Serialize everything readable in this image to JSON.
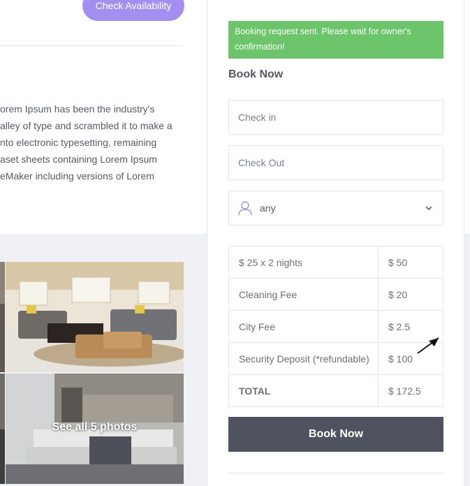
{
  "header": {
    "check_availability_label": "Check Availability"
  },
  "description": {
    "lines": [
      "orem Ipsum has been the industry's",
      "alley of type and scrambled it to make a",
      "nto electronic typesetting, remaining",
      "aset sheets containing Lorem Ipsum",
      "eMaker including versions of Lorem"
    ]
  },
  "gallery": {
    "see_all_label": "See all 5 photos"
  },
  "sidebar": {
    "alert_text": "Booking request sent. Please wait for owner's confirmation!",
    "title": "Book Now",
    "check_in_placeholder": "Check in",
    "check_out_placeholder": "Check Out",
    "guests_value": "any",
    "price_rows": [
      {
        "label": "$ 25 x 2 nights",
        "amount": "$ 50"
      },
      {
        "label": "Cleaning Fee",
        "amount": "$ 20"
      },
      {
        "label": "City Fee",
        "amount": "$ 2.5"
      },
      {
        "label": "Security Deposit (*refundable)",
        "amount": "$ 100"
      },
      {
        "label": "TOTAL",
        "amount": "$ 172.5"
      }
    ],
    "book_button_label": "Book Now"
  },
  "colors": {
    "accent": "#a48ff0",
    "success": "#6cc56a",
    "dark_button": "#4f5360"
  },
  "icons": {
    "guest": "user-icon",
    "dropdown": "chevron-down-icon",
    "annotation": "arrow-icon"
  }
}
